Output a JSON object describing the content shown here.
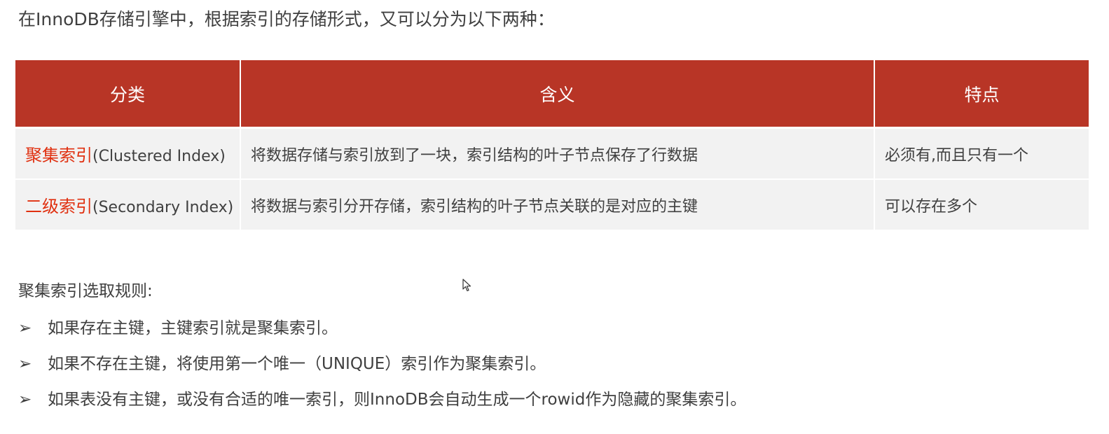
{
  "intro": "在InnoDB存储引擎中，根据索引的存储形式，又可以分为以下两种：",
  "table": {
    "headers": [
      "分类",
      "含义",
      "特点"
    ],
    "rows": [
      {
        "name": "聚集索引",
        "name_en": "(Clustered Index)",
        "meaning": "将数据存储与索引放到了一块，索引结构的叶子节点保存了行数据",
        "feature": "必须有,而且只有一个"
      },
      {
        "name": "二级索引",
        "name_en": "(Secondary Index)",
        "meaning": "将数据与索引分开存储，索引结构的叶子节点关联的是对应的主键",
        "feature": "可以存在多个"
      }
    ]
  },
  "rules": {
    "title": "聚集索引选取规则:",
    "bullet": "➢",
    "items": [
      "如果存在主键，主键索引就是聚集索引。",
      "如果不存在主键，将使用第一个唯一（UNIQUE）索引作为聚集索引。",
      "如果表没有主键，或没有合适的唯一索引，则InnoDB会自动生成一个rowid作为隐藏的聚集索引。"
    ]
  },
  "colors": {
    "header_bg": "#b83526",
    "row_bg": "#f2f2f2",
    "highlight": "#e03010"
  }
}
